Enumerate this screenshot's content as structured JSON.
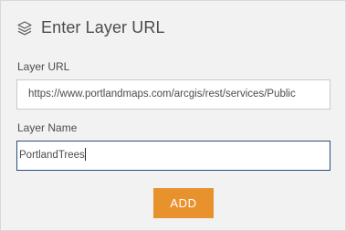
{
  "header": {
    "title": "Enter Layer URL",
    "icon": "layers-icon"
  },
  "layer_url": {
    "label": "Layer URL",
    "value": "https://www.portlandmaps.com/arcgis/rest/services/Public"
  },
  "layer_name": {
    "label": "Layer Name",
    "value": "PortlandTrees"
  },
  "add_button": {
    "label": "ADD",
    "color": "#e8922e"
  },
  "colors": {
    "panel_bg": "#f2f2f2",
    "text": "#4c4c4c",
    "focus_border": "#2a4d7a"
  }
}
